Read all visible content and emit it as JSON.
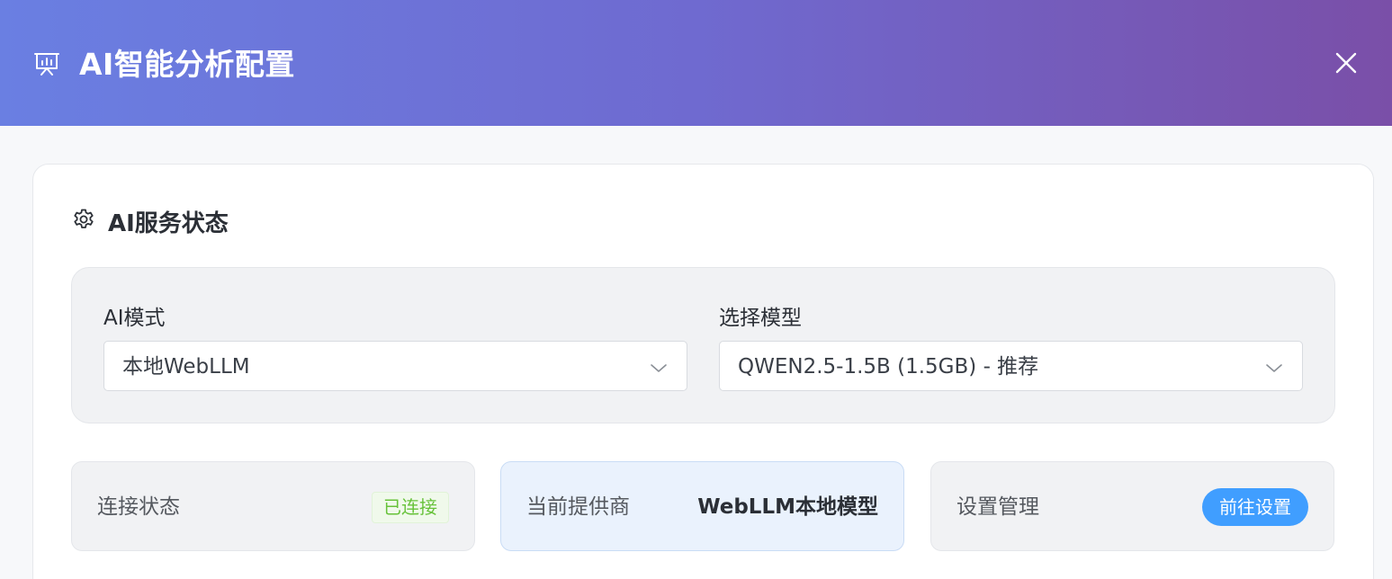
{
  "dialog": {
    "title": "AI智能分析配置",
    "header_icon": "presentation-board-icon",
    "close_icon": "close-icon",
    "gradient_colors": [
      "#6a7fe2",
      "#7a4fa8"
    ]
  },
  "service_status": {
    "title": "AI服务状态",
    "icon": "gear-icon"
  },
  "selects": {
    "ai_mode": {
      "label": "AI模式",
      "value": "本地WebLLM"
    },
    "model": {
      "label": "选择模型",
      "value": "QWEN2.5-1.5B (1.5GB) - 推荐"
    }
  },
  "stats": {
    "connection": {
      "label": "连接状态",
      "badge": "已连接",
      "badge_color": "#67c23a"
    },
    "provider": {
      "label": "当前提供商",
      "value": "WebLLM本地模型"
    },
    "settings": {
      "label": "设置管理",
      "button": "前往设置",
      "button_color": "#409eff"
    }
  }
}
